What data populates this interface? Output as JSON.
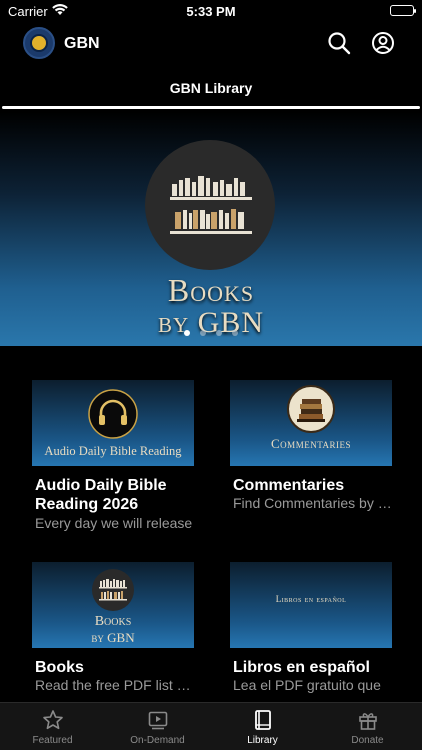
{
  "status_bar": {
    "carrier": "Carrier",
    "time": "5:33 PM"
  },
  "header": {
    "app_name": "GBN"
  },
  "section_title": "GBN Library",
  "hero": {
    "title_line1": "Books",
    "title_line2": "by GBN",
    "page_count": 4,
    "active_page": 0
  },
  "cards": [
    {
      "title": "Audio Daily Bible Reading 2026",
      "description": "Every day we will release",
      "thumb_text": "Audio Daily Bible Reading"
    },
    {
      "title": "Commentaries",
      "description": "Find Commentaries by book",
      "thumb_text": "Commentaries"
    },
    {
      "title": "Books",
      "description": "Read the free PDF list of books",
      "thumb_text_line1": "Books",
      "thumb_text_line2": "by GBN"
    },
    {
      "title": "Libros en español",
      "description": "Lea el PDF gratuito que",
      "thumb_text": "Libros en español"
    }
  ],
  "tabs": [
    {
      "label": "Featured",
      "icon": "star-icon",
      "active": false
    },
    {
      "label": "On-Demand",
      "icon": "video-icon",
      "active": false
    },
    {
      "label": "Library",
      "icon": "book-icon",
      "active": true
    },
    {
      "label": "Donate",
      "icon": "gift-icon",
      "active": false
    }
  ],
  "colors": {
    "accent_blue": "#2676b2",
    "book_cream": "#e8dcc2",
    "inactive_tab": "#8a8a8a"
  }
}
